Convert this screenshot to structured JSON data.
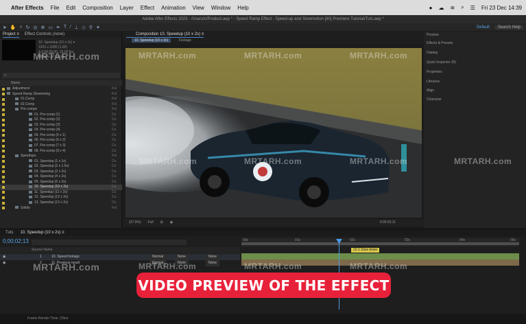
{
  "menubar": {
    "apple": "",
    "app": "After Effects",
    "items": [
      "File",
      "Edit",
      "Composition",
      "Layer",
      "Effect",
      "Animation",
      "View",
      "Window",
      "Help"
    ],
    "clock": "Fri 23 Dec 14:39"
  },
  "window_title": "Adobe After Effects 2023 - /Users/c/Product.aep * - Speed Ramp Effect - Speed-up and Slowmotion [80] Premiere Tutorial/Tuts.aep *",
  "toolbar": {
    "workspace": "Default",
    "search": "Search Help"
  },
  "project": {
    "tabs": [
      "Project ≡",
      "Effect Controls (none)"
    ],
    "thumb_info": [
      "10. Speedup (10 x 2s) ▾",
      "1920 x 1080 (1.00)",
      "Δ 0;00;05;00, 25.00 fps",
      "Millions of Colors"
    ],
    "search_placeholder": "",
    "column_header": "Name",
    "items": [
      {
        "name": "Adjustment",
        "type": "Fol"
      },
      {
        "name": "Speed Ramp Slowmoing",
        "type": "Fol"
      },
      {
        "name": "01.Comp",
        "type": "Fol"
      },
      {
        "name": "02.Comp",
        "type": "Fol"
      },
      {
        "name": "Pre-comps",
        "type": "Fol"
      },
      {
        "name": "01. Pre-comp (1)",
        "type": "Co"
      },
      {
        "name": "02. Pre-comp (2)",
        "type": "Co"
      },
      {
        "name": "03. Pre-comp (3)",
        "type": "Co"
      },
      {
        "name": "04. Pre-comp (4)",
        "type": "Co"
      },
      {
        "name": "05. Pre-comp (5 x 1)",
        "type": "Co"
      },
      {
        "name": "06. Pre-comp (6 x 2)",
        "type": "Co"
      },
      {
        "name": "07. Pre-comp (7 x 3)",
        "type": "Co"
      },
      {
        "name": "08. Pre-comp (8 x 4)",
        "type": "Co"
      },
      {
        "name": "Speedups",
        "type": "Fol"
      },
      {
        "name": "01. Speedup (1 x 1s)",
        "type": "Co"
      },
      {
        "name": "02. Speedup (2 x 1.5s)",
        "type": "Co"
      },
      {
        "name": "03. Speedup (3 x 2s)",
        "type": "Co"
      },
      {
        "name": "04. Speedup (4 x 2s)",
        "type": "Co"
      },
      {
        "name": "05. Speedup (5 x 2s)",
        "type": "Co"
      },
      {
        "name": "10. Speedup (10 x 2s)",
        "type": "Co",
        "selected": true
      },
      {
        "name": "11. Speedup (11 x 2s)",
        "type": "Co"
      },
      {
        "name": "12. Speedup (12 x 2s)",
        "type": "Co"
      },
      {
        "name": "13. Speedup (13 x 2s)",
        "type": "Co"
      },
      {
        "name": "Solids",
        "type": "Fol"
      }
    ]
  },
  "comp": {
    "tab": "Composition 10. Speedup (10 x 2s) ≡",
    "subtabs": [
      "10. Speedup (10 x 2s)",
      "Footage"
    ],
    "zoom": "(37.5%)",
    "resolution": "Full",
    "timecode": "0;00;02;11"
  },
  "right_panel": {
    "items": [
      "Preview",
      "Effects & Presets",
      "Display",
      "Quick Inspector (R)",
      "Properties",
      "Libraries",
      "Align",
      "Character"
    ]
  },
  "timeline": {
    "tabs": [
      "Tuts",
      "10. Speedup (10 x 2s) ≡"
    ],
    "time": "0;00;02;13",
    "header": "Source Name",
    "layers": [
      {
        "num": "1",
        "name": "10. Speed footage",
        "mode": "Normal",
        "trk": "None",
        "parent": "None"
      },
      {
        "num": "2",
        "name": "11. Previous result",
        "mode": "Normal",
        "trk": "None",
        "parent": "None"
      }
    ],
    "marker": "10.1 Slow down",
    "ruler": [
      "00s",
      "01s",
      "02s",
      "03s",
      "04s",
      "05s"
    ],
    "status": "Frame Render Time: 23ms"
  },
  "overlay": {
    "caption": "VIDEO PREVIEW OF THE EFFECT",
    "watermark": "MRTARH.com"
  },
  "colors": {
    "accent": "#4a9be8",
    "caption_bg": "#e8213a",
    "track_green": "#6d8d4a",
    "track_brown": "#7e6a4a"
  }
}
